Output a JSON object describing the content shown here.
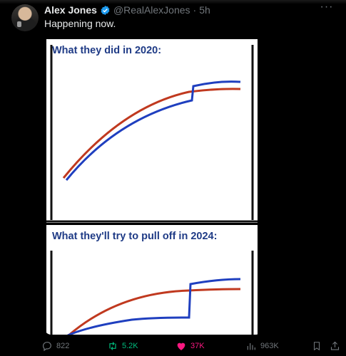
{
  "author": {
    "name": "Alex Jones",
    "handle": "@RealAlexJones",
    "separator": "·",
    "time": "5h"
  },
  "tweet": {
    "text": "Happening now."
  },
  "media": {
    "panel1_title": "What they did in 2020:",
    "panel2_title": "What they'll try to pull off in 2024:",
    "colors": {
      "red_line": "#c0391f",
      "blue_line": "#1f3fbf",
      "title": "#1f3b86"
    }
  },
  "actions": {
    "replies": "822",
    "retweets": "5.2K",
    "likes": "37K",
    "views": "963K"
  },
  "colors": {
    "background": "#000000",
    "text_primary": "#e7e9ea",
    "text_secondary": "#71767b",
    "verified": "#1d9bf0",
    "retweet": "#00ba7c",
    "like": "#f91880"
  }
}
